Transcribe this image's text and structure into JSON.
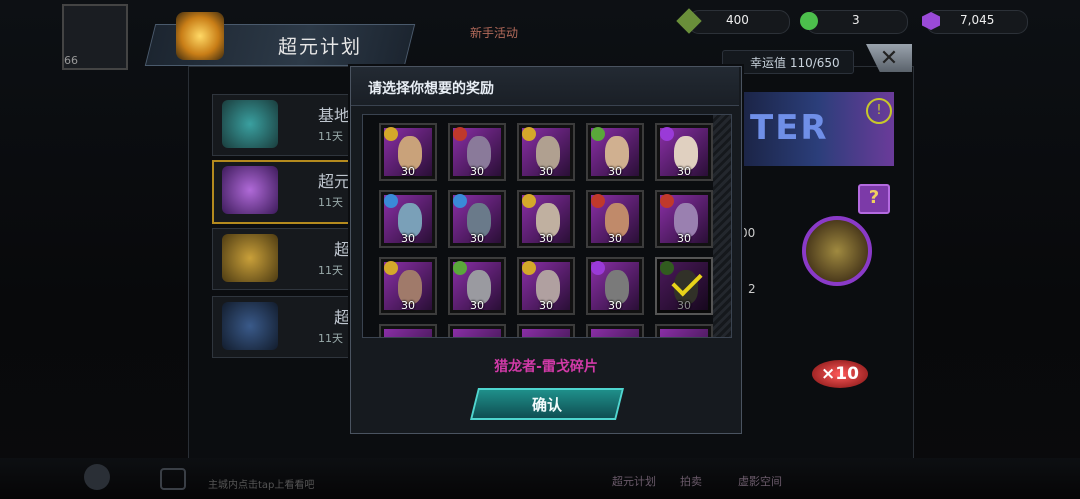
{
  "header": {
    "level": "66",
    "title": "超元计划",
    "event_tab": "新手活动"
  },
  "resources": [
    {
      "icon": "gem-icon",
      "value": "400",
      "color": "#6a8f3a"
    },
    {
      "icon": "coin-icon",
      "value": "3",
      "color": "#4cbf4c"
    },
    {
      "icon": "crystal-icon",
      "value": "7,045",
      "color": "#9a4ad8"
    }
  ],
  "luck": {
    "text": "幸运值 110/650"
  },
  "side_list": [
    {
      "label": "基地",
      "timer": "11天"
    },
    {
      "label": "超元",
      "timer": "11天"
    },
    {
      "label": "超",
      "timer": "11天"
    },
    {
      "label": "超",
      "timer": "11天"
    }
  ],
  "right_panel": {
    "banner_text": "TER",
    "info": "!",
    "help": "?",
    "multiplier": "×10",
    "slot_a": "00",
    "slot_b": "2"
  },
  "dialog": {
    "title": "请选择你想要的奖励",
    "selected_name": "猎龙者-雷戈碎片",
    "confirm_label": "确认",
    "rewards": [
      {
        "count": "30",
        "color": "#8a2fa6",
        "role": "gold"
      },
      {
        "count": "30",
        "color": "#8a2fa6",
        "role": "red"
      },
      {
        "count": "30",
        "color": "#8a2fa6",
        "role": "gold"
      },
      {
        "count": "30",
        "color": "#8a2fa6",
        "role": "green"
      },
      {
        "count": "30",
        "color": "#8a2fa6",
        "role": "purple"
      },
      {
        "count": "30",
        "color": "#8a2fa6",
        "role": "blue"
      },
      {
        "count": "30",
        "color": "#8a2fa6",
        "role": "blue"
      },
      {
        "count": "30",
        "color": "#8a2fa6",
        "role": "gold"
      },
      {
        "count": "30",
        "color": "#8a2fa6",
        "role": "red"
      },
      {
        "count": "30",
        "color": "#8a2fa6",
        "role": "red"
      },
      {
        "count": "30",
        "color": "#8a2fa6",
        "role": "gold"
      },
      {
        "count": "30",
        "color": "#8a2fa6",
        "role": "green"
      },
      {
        "count": "30",
        "color": "#8a2fa6",
        "role": "gold"
      },
      {
        "count": "30",
        "color": "#8a2fa6",
        "role": "purple"
      },
      {
        "count": "30",
        "color": "#8a2fa6",
        "role": "green",
        "selected": true
      }
    ]
  },
  "footer": {
    "ticker": "主城内点击tap上看看吧",
    "tabs": [
      "超元计划",
      "拍卖",
      "虚影空间"
    ]
  }
}
